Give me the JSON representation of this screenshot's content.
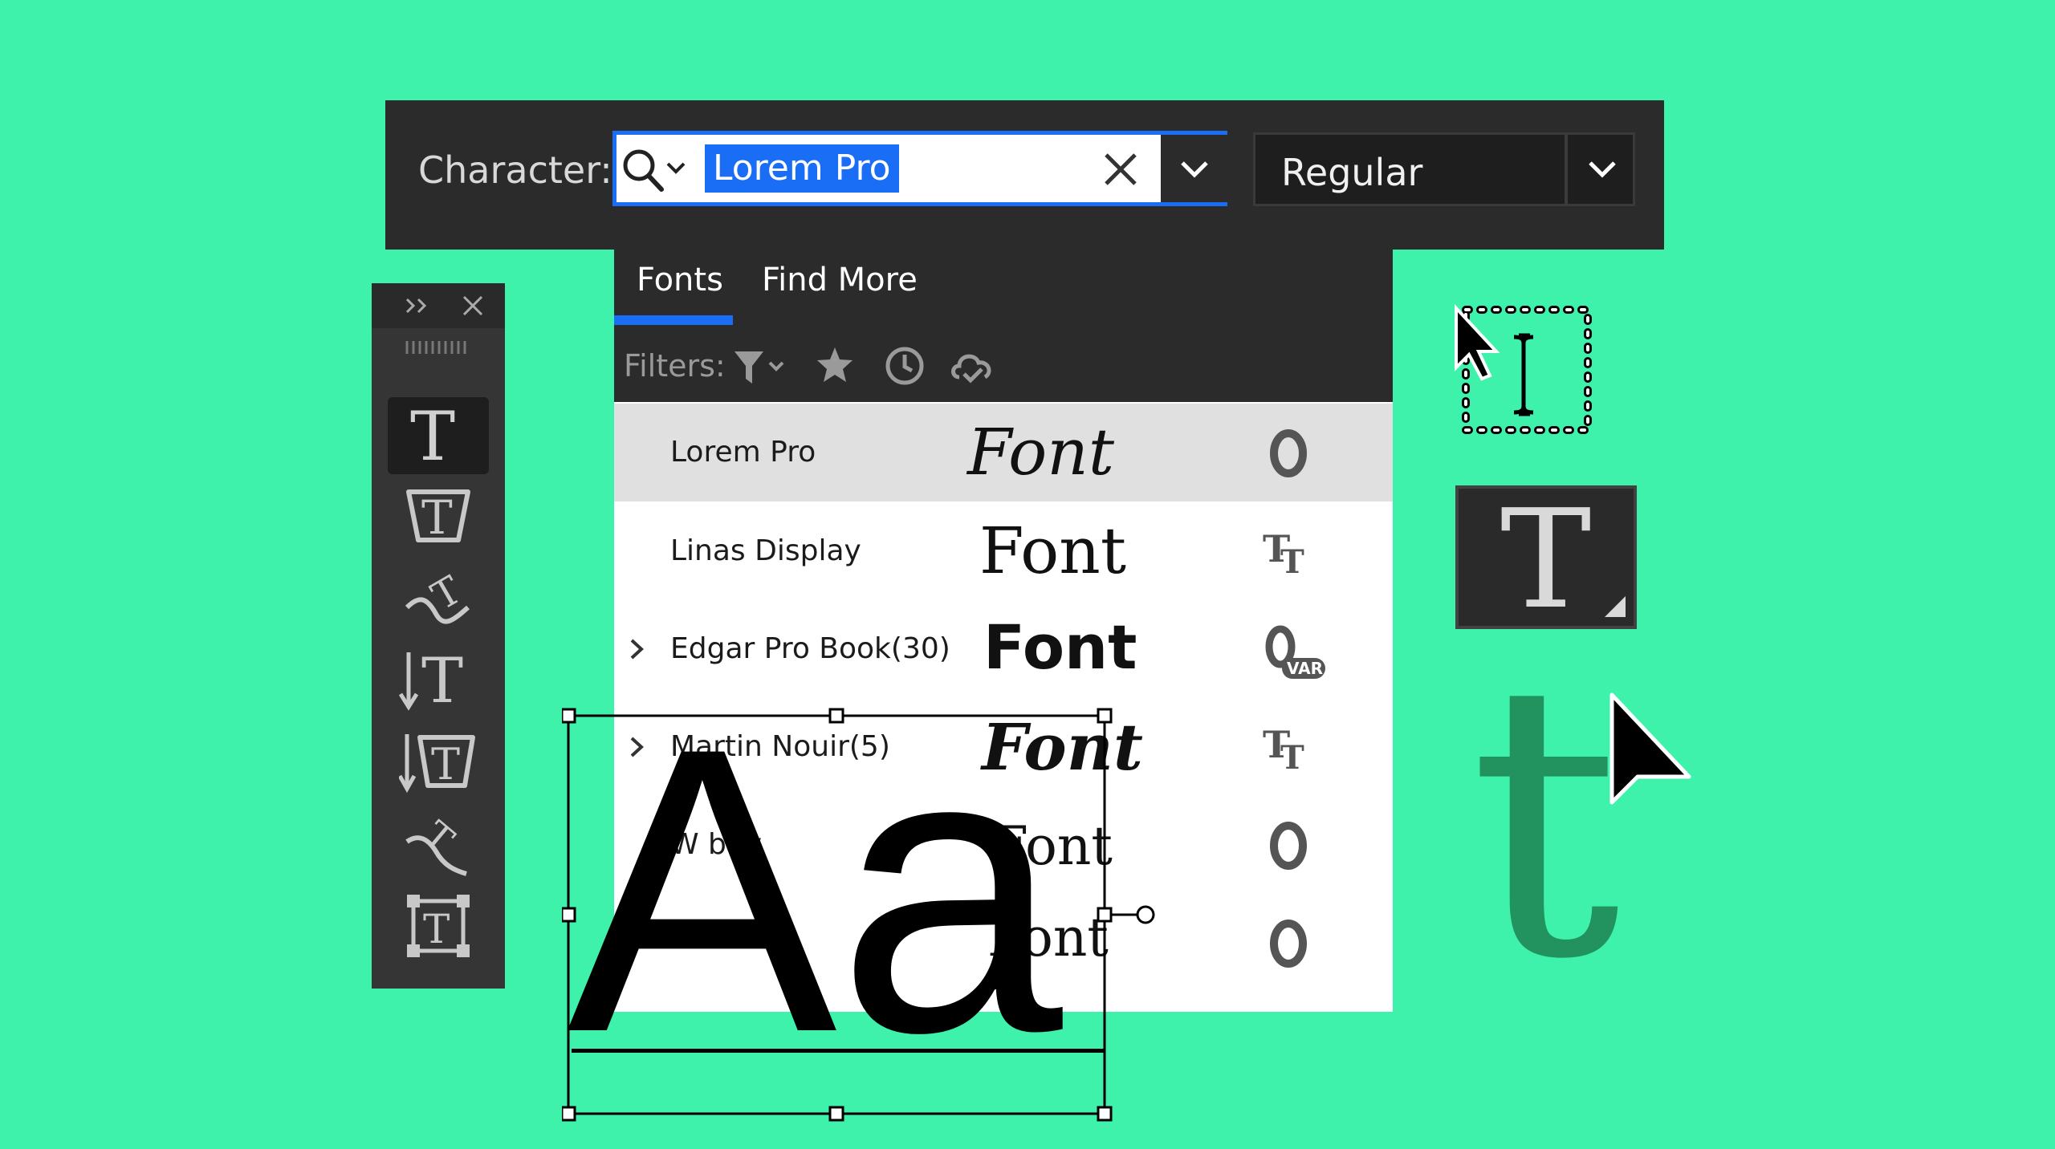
{
  "character_bar": {
    "label": "Character:",
    "search_value": "Lorem Pro",
    "style_value": "Regular"
  },
  "font_panel": {
    "tabs": [
      {
        "label": "Fonts",
        "active": true
      },
      {
        "label": "Find More",
        "active": false
      }
    ],
    "filters_label": "Filters:",
    "filter_icons": [
      "filter-icon",
      "star-icon",
      "clock-icon",
      "cloud-icon"
    ],
    "rows": [
      {
        "name": "Lorem Pro",
        "preview": "Font",
        "type": "opentype",
        "highlighted": true,
        "expandable": false
      },
      {
        "name": "Linas Display",
        "preview": "Font",
        "type": "truetype",
        "highlighted": false,
        "expandable": false
      },
      {
        "name": "Edgar Pro Book(30)",
        "preview": "Font",
        "type": "variable",
        "badge": "VAR",
        "highlighted": false,
        "expandable": true
      },
      {
        "name": "Martin Nouir(5)",
        "preview": "Font",
        "type": "truetype",
        "highlighted": false,
        "expandable": true
      },
      {
        "name": "W   bby",
        "preview": "Font",
        "type": "opentype",
        "highlighted": false,
        "expandable": false
      },
      {
        "name": "",
        "preview": "Font",
        "type": "opentype",
        "highlighted": false,
        "expandable": false
      }
    ]
  },
  "tools_panel": {
    "tools": [
      "horizontal-type-tool",
      "horizontal-type-mask-tool",
      "type-on-path-tool",
      "vertical-type-tool",
      "vertical-type-mask-tool",
      "vertical-type-on-path-tool",
      "area-type-tool"
    ]
  },
  "canvas": {
    "sample_text": "Aa",
    "big_type_glyph": "T",
    "green_glyph": "t"
  },
  "colors": {
    "background": "#3ff2ab",
    "panel_dark": "#2b2b2b",
    "accent_blue": "#1a6ef5",
    "highlight_row": "#e0e0e0",
    "green_glyph": "#22925f"
  }
}
